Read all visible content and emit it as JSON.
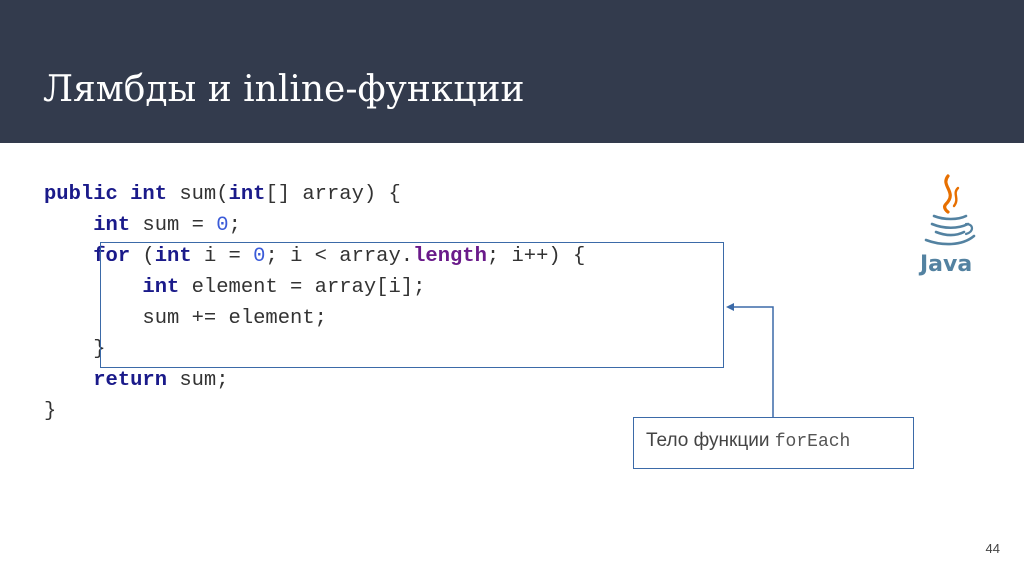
{
  "slide": {
    "title": "Лямбды и inline-функции",
    "page_number": "44"
  },
  "code_lines": [
    [
      {
        "t": "public",
        "c": "kw"
      },
      {
        "t": " "
      },
      {
        "t": "int",
        "c": "kw"
      },
      {
        "t": " sum("
      },
      {
        "t": "int",
        "c": "kw"
      },
      {
        "t": "[] array) {"
      }
    ],
    [
      {
        "t": "    "
      },
      {
        "t": "int",
        "c": "kw"
      },
      {
        "t": " sum = "
      },
      {
        "t": "0",
        "c": "num"
      },
      {
        "t": ";"
      }
    ],
    [
      {
        "t": "    "
      },
      {
        "t": "for",
        "c": "kw"
      },
      {
        "t": " ("
      },
      {
        "t": "int",
        "c": "kw"
      },
      {
        "t": " i = "
      },
      {
        "t": "0",
        "c": "num"
      },
      {
        "t": "; i < array."
      },
      {
        "t": "length",
        "c": "fld"
      },
      {
        "t": "; i++) {"
      }
    ],
    [
      {
        "t": "        "
      },
      {
        "t": "int",
        "c": "kw"
      },
      {
        "t": " element = array[i];"
      }
    ],
    [
      {
        "t": "        sum += element;"
      }
    ],
    [
      {
        "t": "    }"
      }
    ],
    [
      {
        "t": "    "
      },
      {
        "t": "return",
        "c": "kw"
      },
      {
        "t": " sum;"
      }
    ],
    [
      {
        "t": "}"
      }
    ]
  ],
  "callout": {
    "text": "Тело функции",
    "code": "forEach"
  },
  "logo": {
    "name": "java-logo-icon",
    "text": "Java",
    "colors": {
      "cup": "#5382a1",
      "steam": "#e76f00"
    }
  },
  "colors": {
    "header_bg": "#333b4d",
    "keyword": "#1a1a8a",
    "number": "#3b5bd8",
    "field": "#6a1a8a",
    "box_border": "#3b6aa8"
  }
}
